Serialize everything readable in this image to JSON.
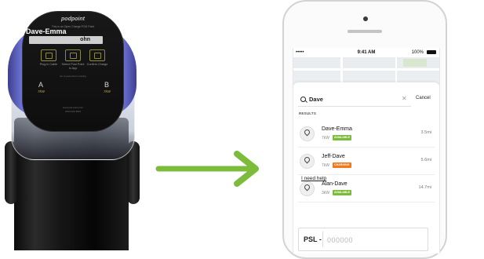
{
  "charger": {
    "brand": "podpoint",
    "subtitle": "This is an Open Charge POD Point",
    "name": "Dave-Emma",
    "field_value": "ohn",
    "steps": [
      {
        "label": "Plug in Cable"
      },
      {
        "label": "Select Post Point In App"
      },
      {
        "label": "Confirm Charge"
      }
    ],
    "ports": [
      {
        "letter": "A",
        "power": "7kW"
      },
      {
        "letter": "B",
        "power": "7kW"
      }
    ],
    "fine_print": "Go to pod-point.com/plug",
    "fine_print_2": "www.pod-point.com",
    "fine_print_3": "0333 006 3503"
  },
  "arrow": {
    "color": "#7dbb3a"
  },
  "phone": {
    "status": {
      "signal": "•••••",
      "time": "9:41 AM",
      "battery": "100%"
    },
    "search": {
      "value": "Dave",
      "cancel_label": "Cancel"
    },
    "results_label": "RESULTS",
    "results": [
      {
        "name": "Dave-Emma",
        "power": "7kW",
        "status": "AVAILABLE",
        "status_color": "#7dbb3a",
        "distance": "3.5mi"
      },
      {
        "name": "Jeff-Dave",
        "power": "7kW",
        "status": "CHARGING",
        "status_color": "#f07a1a",
        "distance": "5.6mi"
      },
      {
        "name": "Alan-Dave",
        "power": "3kW",
        "status": "AVAILABLE",
        "status_color": "#7dbb3a",
        "distance": "14.7mi"
      }
    ],
    "help_label": "I need help",
    "psl": {
      "prefix": "PSL -",
      "placeholder": "000000"
    }
  }
}
